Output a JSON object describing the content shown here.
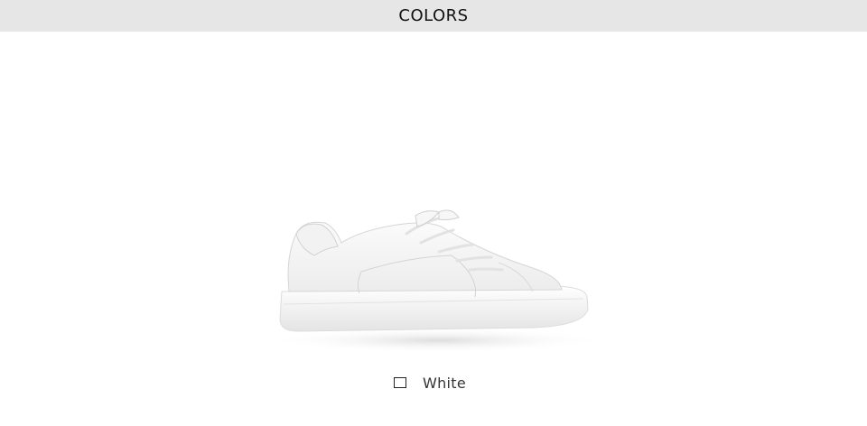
{
  "header": {
    "title": "COLORS"
  },
  "product": {
    "image_icon": "white-sneaker-image"
  },
  "color_options": [
    {
      "label": "White",
      "swatch_color": "#ffffff",
      "icon": "swatch-square-icon"
    }
  ],
  "colors": {
    "header_bg": "#e6e6e6",
    "page_bg": "#ffffff",
    "text": "#111111"
  }
}
